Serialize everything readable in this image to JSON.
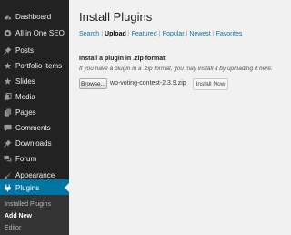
{
  "sidebar": {
    "items": [
      {
        "label": "Dashboard",
        "icon": "dashboard-icon"
      },
      {
        "label": "All in One SEO",
        "icon": "seo-icon"
      },
      {
        "label": "Posts",
        "icon": "pushpin-icon"
      },
      {
        "label": "Portfolio Items",
        "icon": "portfolio-icon"
      },
      {
        "label": "Slides",
        "icon": "slides-icon"
      },
      {
        "label": "Media",
        "icon": "media-icon"
      },
      {
        "label": "Pages",
        "icon": "pages-icon"
      },
      {
        "label": "Comments",
        "icon": "comments-icon"
      },
      {
        "label": "Downloads",
        "icon": "pushpin-icon"
      },
      {
        "label": "Forum",
        "icon": "forum-icon"
      },
      {
        "label": "Appearance",
        "icon": "appearance-icon"
      },
      {
        "label": "Plugins",
        "icon": "plugins-icon"
      }
    ],
    "active": "Plugins",
    "submenu": [
      "Installed Plugins",
      "Add New",
      "Editor"
    ],
    "submenu_current": "Add New"
  },
  "main": {
    "title": "Install Plugins",
    "tabs": [
      "Search",
      "Upload",
      "Featured",
      "Popular",
      "Newest",
      "Favorites"
    ],
    "current_tab": "Upload",
    "separator": "|",
    "upload_heading": "Install a plugin in .zip format",
    "upload_help": "If you have a plugin in a .zip format, you may install it by uploading it here.",
    "browse_label": "Browse...",
    "file_name": "wp-voting-contest-2.3.9.zip",
    "install_label": "Install Now"
  },
  "colors": {
    "sidebar_bg": "#222222",
    "active_bg": "#0074a2",
    "link": "#0074a2",
    "page_bg": "#f1f1f1"
  }
}
